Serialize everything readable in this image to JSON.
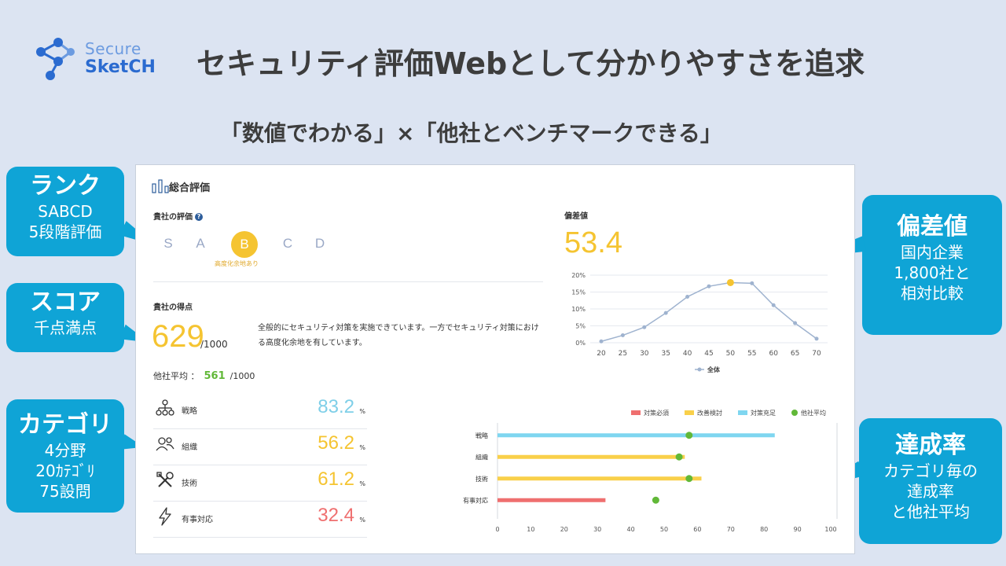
{
  "logo": {
    "line1": "Secure",
    "line2": "SketCH"
  },
  "title": "セキュリティ評価Webとして分かりやすさを追求",
  "subtitle": "「数値でわかる」×「他社とベンチマークできる」",
  "callouts": {
    "rank": {
      "title": "ランク",
      "lines": [
        "SABCD",
        "5段階評価"
      ]
    },
    "score": {
      "title": "スコア",
      "lines": [
        "千点満点"
      ]
    },
    "category": {
      "title": "カテゴリ",
      "lines": [
        "4分野",
        "20ｶﾃｺﾞﾘ",
        "75設問"
      ]
    },
    "deviation": {
      "title": "偏差値",
      "lines": [
        "国内企業",
        "1,800社と",
        "相対比較"
      ]
    },
    "achievement": {
      "title": "達成率",
      "lines": [
        "カテゴリ毎の",
        "達成率",
        "と他社平均"
      ]
    }
  },
  "card": {
    "title": "総合評価",
    "company_eval_label": "貴社の評価",
    "help_symbol": "?",
    "ranks": [
      "S",
      "A",
      "B",
      "C",
      "D"
    ],
    "selected_rank": "B",
    "rank_note": "高度化余地あり",
    "score_label": "貴社の得点",
    "score": "629",
    "score_max": "/1000",
    "description": "全般的にセキュリティ対策を実施できています。一方でセキュリティ対策における高度化余地を有しています。",
    "avg_label": "他社平均 ：",
    "avg_value": "561",
    "avg_max": "/1000",
    "deviation_label": "偏差値",
    "deviation_value": "53.4",
    "categories": [
      {
        "label": "戦略",
        "value": "83.2",
        "unit": "%",
        "color": "#7fcfe8",
        "icon": "strategy-icon"
      },
      {
        "label": "組織",
        "value": "56.2",
        "unit": "%",
        "color": "#f5c431",
        "icon": "organization-icon"
      },
      {
        "label": "技術",
        "value": "61.2",
        "unit": "%",
        "color": "#f5c431",
        "icon": "tools-icon"
      },
      {
        "label": "有事対応",
        "value": "32.4",
        "unit": "%",
        "color": "#ef6f6f",
        "icon": "lightning-icon"
      }
    ]
  },
  "chart_data": [
    {
      "type": "line",
      "x": [
        20,
        25,
        30,
        35,
        40,
        45,
        50,
        55,
        60,
        65,
        70
      ],
      "series": [
        {
          "name": "全体",
          "values": [
            0.4,
            2.2,
            4.6,
            8.8,
            13.6,
            16.7,
            17.8,
            17.6,
            11.1,
            5.8,
            1.2
          ],
          "color": "#9fb3cf"
        }
      ],
      "highlight": {
        "x": 50,
        "y": 17.8,
        "color": "#f5c431"
      },
      "y_ticks": [
        "0%",
        "5%",
        "10%",
        "15%",
        "20%"
      ],
      "x_ticks": [
        "20",
        "25",
        "30",
        "35",
        "40",
        "45",
        "50",
        "55",
        "60",
        "65",
        "70"
      ],
      "ylim": [
        0,
        20
      ],
      "legend": "bottom-center"
    },
    {
      "type": "bar",
      "orientation": "horizontal",
      "categories": [
        "戦略",
        "組織",
        "技術",
        "有事対応"
      ],
      "values": [
        83.2,
        56.2,
        61.2,
        32.4
      ],
      "bar_colors": [
        "#7fd6f0",
        "#f9d04a",
        "#f9d04a",
        "#ef6f6f"
      ],
      "others_avg": [
        57.5,
        54.5,
        57.5,
        47.5
      ],
      "others_color": "#61b838",
      "x_ticks": [
        "0",
        "10",
        "20",
        "30",
        "40",
        "50",
        "60",
        "70",
        "80",
        "90",
        "100"
      ],
      "xlim": [
        0,
        100
      ],
      "legend": [
        {
          "name": "対策必須",
          "color": "#ef6f6f"
        },
        {
          "name": "改善検討",
          "color": "#f9d04a"
        },
        {
          "name": "対策充足",
          "color": "#7fd6f0"
        },
        {
          "name": "他社平均",
          "color": "#61b838"
        }
      ],
      "legend_position": "top-right"
    }
  ]
}
